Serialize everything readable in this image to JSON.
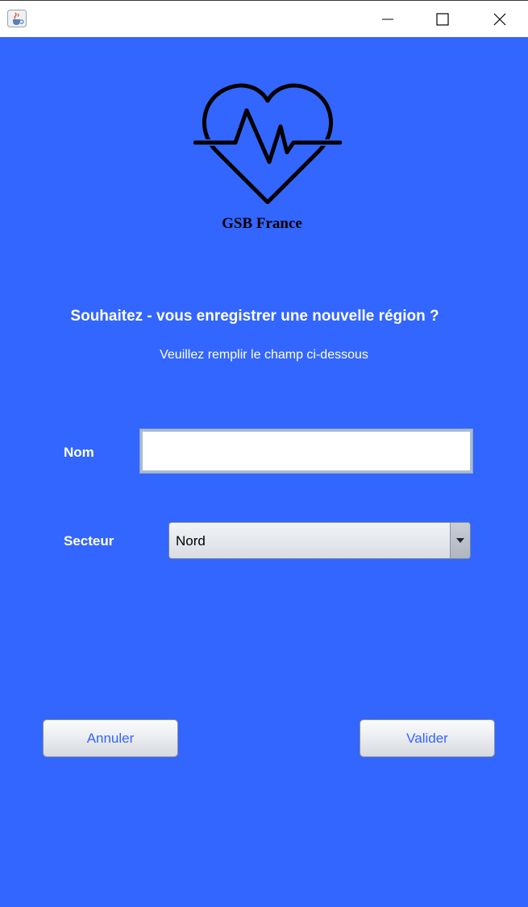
{
  "window": {
    "app_icon": "java-cup-icon",
    "controls": {
      "minimize": "minimize-icon",
      "maximize": "maximize-icon",
      "close": "close-icon"
    }
  },
  "colors": {
    "background": "#3366ff",
    "button_text": "#3366ff",
    "logo": "#000000"
  },
  "logo": {
    "icon": "heartbeat-heart-icon",
    "brand": "GSB France"
  },
  "form": {
    "question": "Souhaitez - vous enregistrer une nouvelle région ?",
    "instruction": "Veuillez remplir le champ ci-dessous",
    "nom_label": "Nom",
    "nom_value": "",
    "secteur_label": "Secteur",
    "secteur_value": "Nord"
  },
  "actions": {
    "cancel_label": "Annuler",
    "submit_label": "Valider"
  }
}
